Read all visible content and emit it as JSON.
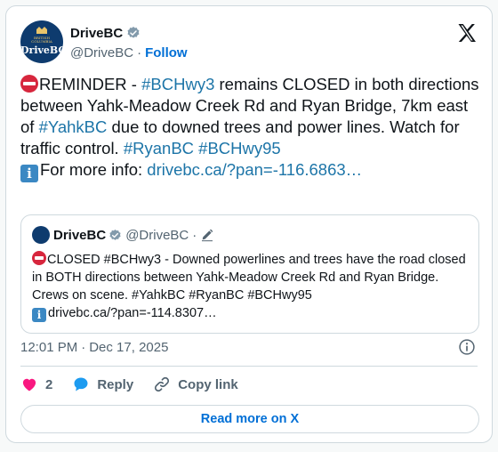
{
  "colors": {
    "link": "#1d75a8",
    "follow": "#006fd6",
    "secondary_text": "#536471",
    "border": "#cfd9de",
    "like": "#f91880",
    "verified": "#829aab",
    "reply": "#1d9bf0"
  },
  "author": {
    "avatar_small_text_1": "BRITISH",
    "avatar_small_text_2": "COLUMBIA",
    "avatar_brand": "DriveBC",
    "display_name": "DriveBC",
    "verified_icon": "verified-badge-icon",
    "handle": "@DriveBC",
    "separator": "·",
    "follow_label": "Follow"
  },
  "tweet": {
    "segments": [
      {
        "text": "REMINDER - "
      },
      {
        "text": "#BCHwy3",
        "link": true
      },
      {
        "text": " remains CLOSED in both directions between Yahk-Meadow Creek Rd and Ryan Bridge, 7km east of "
      },
      {
        "text": "#YahkBC",
        "link": true
      },
      {
        "text": " due to downed trees and power lines. Watch for traffic control. "
      },
      {
        "text": "#RyanBC",
        "link": true
      },
      {
        "text": " "
      },
      {
        "text": "#BCHwy95",
        "link": true
      }
    ],
    "info_prefix": "For more info: ",
    "info_link": "drivebc.ca/?pan=-116.6863…",
    "emoji_stop": "no-entry-icon",
    "emoji_info": "i"
  },
  "quote": {
    "display_name": "DriveBC",
    "handle": "@DriveBC",
    "separator": "·",
    "text": "CLOSED #BCHwy3 - Downed powerlines and trees have the road closed in BOTH directions between Yahk-Meadow Creek Rd and Ryan Bridge. Crews on scene. #YahkBC #RyanBC #BCHwy95",
    "info_text": "drivebc.ca/?pan=-114.8307…",
    "edit_icon": "pencil-icon"
  },
  "meta": {
    "time": "12:01 PM",
    "separator": "·",
    "date": "Dec 17, 2025"
  },
  "actions": {
    "like_count": "2",
    "reply_label": "Reply",
    "copy_label": "Copy link"
  },
  "read_more_label": "Read more on X"
}
